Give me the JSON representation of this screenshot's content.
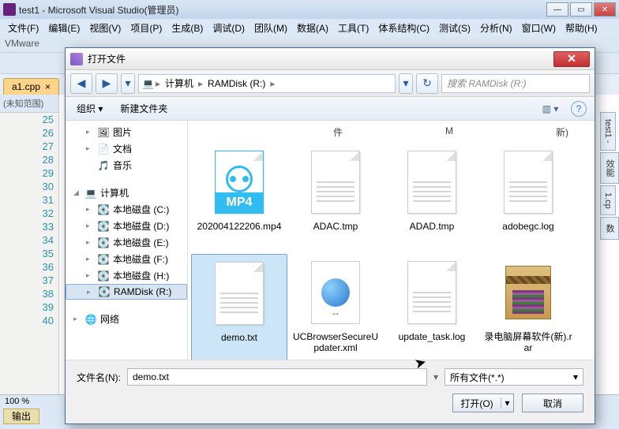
{
  "vs": {
    "title": "test1 - Microsoft Visual Studio(管理员)",
    "menu": [
      "文件(F)",
      "编辑(E)",
      "视图(V)",
      "项目(P)",
      "生成(B)",
      "调试(D)",
      "团队(M)",
      "数据(A)",
      "工具(T)",
      "体系结构(C)",
      "测试(S)",
      "分析(N)",
      "窗口(W)",
      "帮助(H)"
    ],
    "vmware": "VMware",
    "tab": "a1.cpp",
    "scope": "(未知范围)",
    "lines": [
      "25",
      "26",
      "27",
      "28",
      "29",
      "30",
      "31",
      "32",
      "33",
      "34",
      "35",
      "36",
      "37",
      "38",
      "39",
      "40"
    ],
    "zoom": "100 %",
    "output_label": "输出",
    "right_tabs": [
      "test1 -",
      "效能",
      "1.cp",
      "数"
    ]
  },
  "dialog": {
    "title": "打开文件",
    "breadcrumb": {
      "root": "计算机",
      "folder": "RAMDisk (R:)"
    },
    "search_placeholder": "搜索 RAMDisk (R:)",
    "toolbar": {
      "organize": "组织 ▾",
      "newfolder": "新建文件夹"
    },
    "columns": {
      "c1": "件",
      "c2": "M",
      "c3": "新)"
    },
    "tree": {
      "pictures": "图片",
      "documents": "文档",
      "music": "音乐",
      "computer": "计算机",
      "drives": [
        "本地磁盘 (C:)",
        "本地磁盘 (D:)",
        "本地磁盘 (E:)",
        "本地磁盘 (F:)",
        "本地磁盘 (H:)",
        "RAMDisk (R:)"
      ],
      "network": "网络"
    },
    "files": [
      {
        "name": "202004122206.mp4",
        "kind": "mp4"
      },
      {
        "name": "ADAC.tmp",
        "kind": "doc"
      },
      {
        "name": "ADAD.tmp",
        "kind": "doc"
      },
      {
        "name": "adobegc.log",
        "kind": "log"
      },
      {
        "name": "demo.txt",
        "kind": "txt",
        "selected": true
      },
      {
        "name": "UCBrowserSecureUpdater.xml",
        "kind": "xml"
      },
      {
        "name": "update_task.log",
        "kind": "log"
      },
      {
        "name": "录电脑屏幕软件(新).rar",
        "kind": "rar"
      }
    ],
    "filename_label": "文件名(N):",
    "filename_value": "demo.txt",
    "filter": "所有文件(*.*)",
    "open_btn": "打开(O)",
    "cancel_btn": "取消"
  }
}
